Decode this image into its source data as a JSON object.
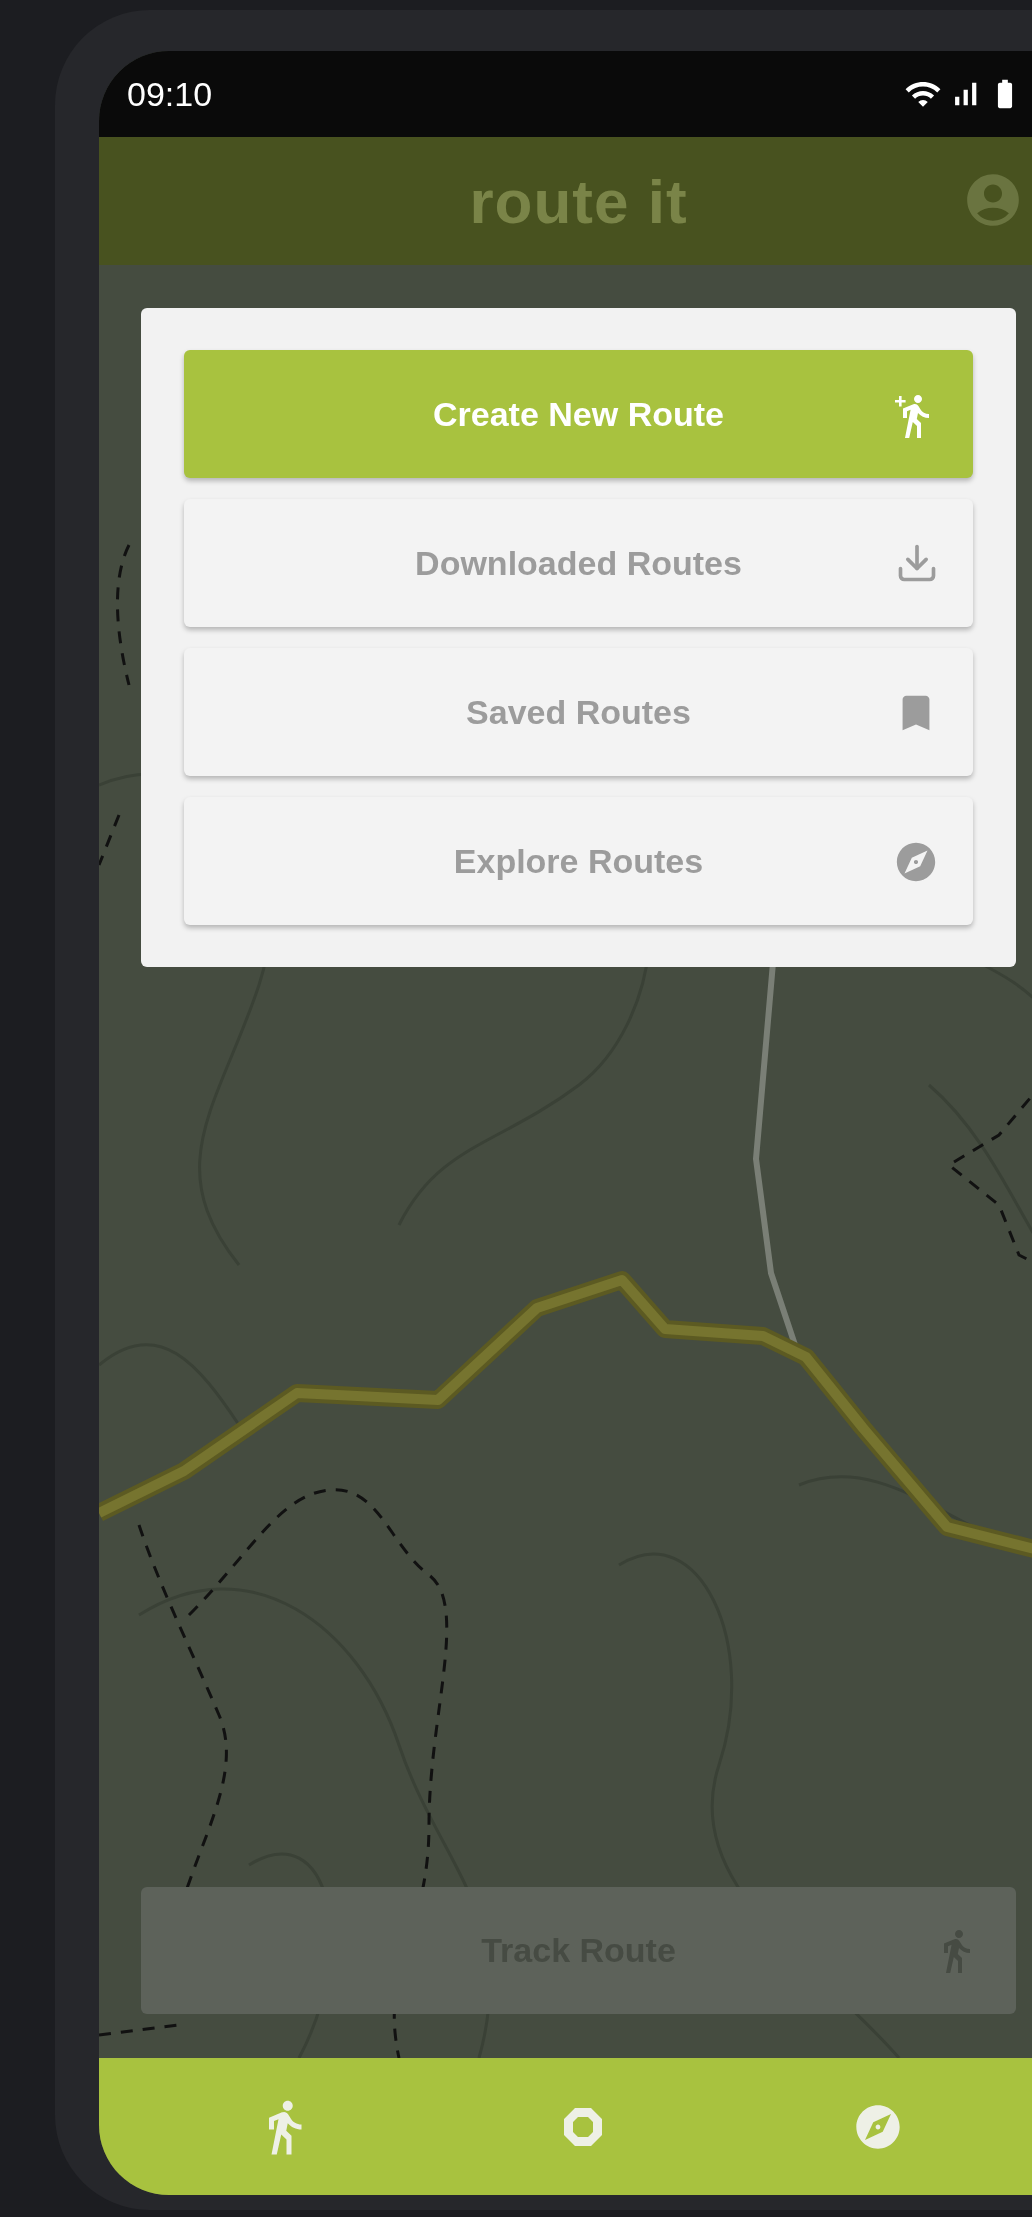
{
  "status_bar": {
    "time": "09:10"
  },
  "app_bar": {
    "title": "route it"
  },
  "menu": {
    "buttons": [
      {
        "label": "Create New Route",
        "primary": true
      },
      {
        "label": "Downloaded Routes",
        "primary": false
      },
      {
        "label": "Saved Routes",
        "primary": false
      },
      {
        "label": "Explore Routes",
        "primary": false
      }
    ]
  },
  "track_button": {
    "label": "Track Route",
    "disabled": true
  }
}
